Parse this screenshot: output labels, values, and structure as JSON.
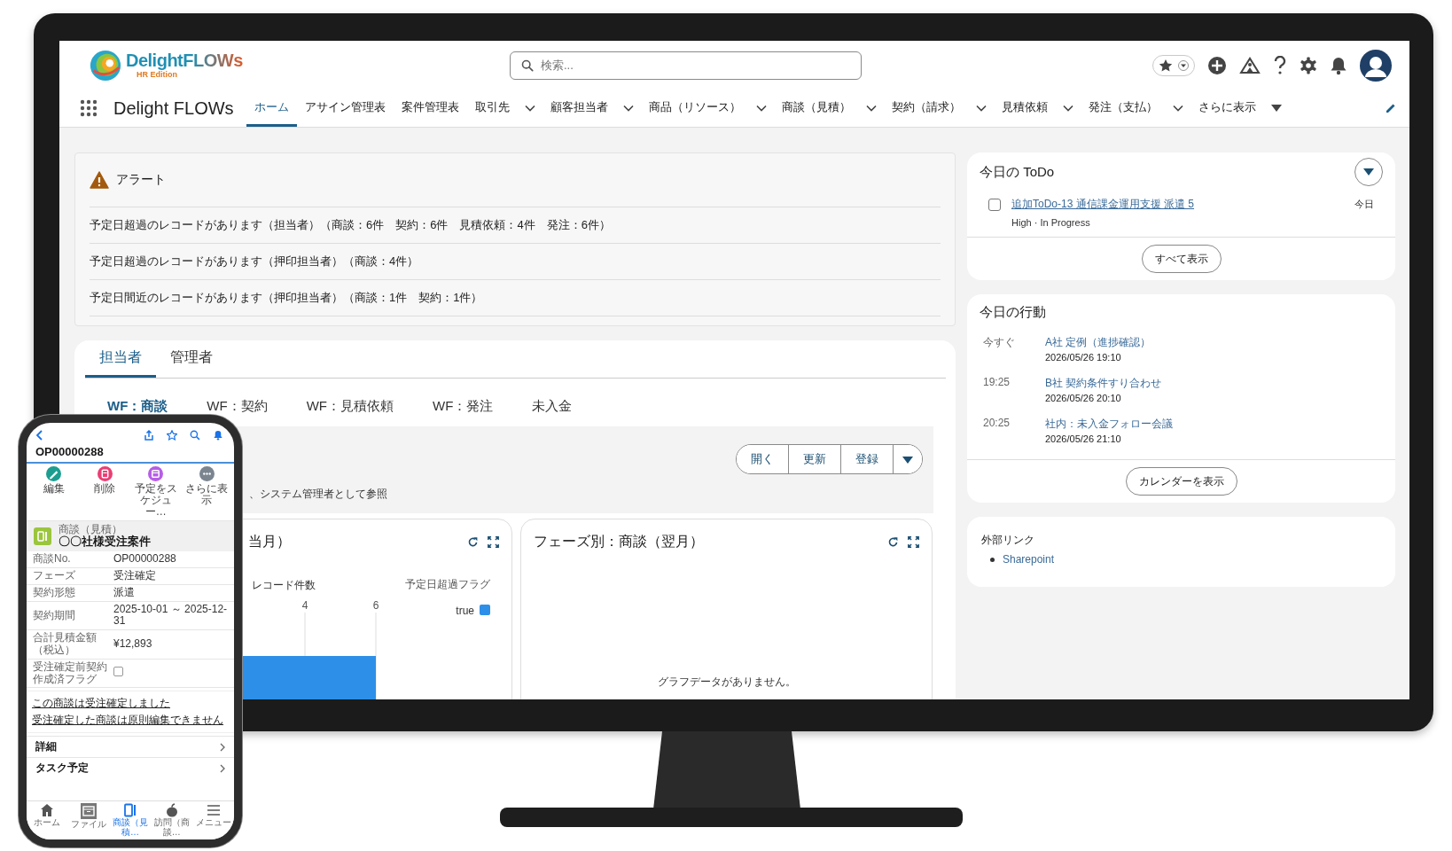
{
  "header": {
    "logo": {
      "name": "DelightFLOWs",
      "edition": "HR Edition"
    },
    "search": {
      "placeholder": "検索..."
    },
    "app_name": "Delight FLOWs",
    "nav": [
      {
        "label": "ホーム",
        "selected": true,
        "menu": false
      },
      {
        "label": "アサイン管理表",
        "selected": false,
        "menu": false
      },
      {
        "label": "案件管理表",
        "selected": false,
        "menu": false
      },
      {
        "label": "取引先",
        "selected": false,
        "menu": true
      },
      {
        "label": "顧客担当者",
        "selected": false,
        "menu": true
      },
      {
        "label": "商品（リソース）",
        "selected": false,
        "menu": true
      },
      {
        "label": "商談（見積）",
        "selected": false,
        "menu": true
      },
      {
        "label": "契約（請求）",
        "selected": false,
        "menu": true
      },
      {
        "label": "見積依頼",
        "selected": false,
        "menu": true
      },
      {
        "label": "発注（支払）",
        "selected": false,
        "menu": true
      }
    ],
    "nav_more": "さらに表示"
  },
  "main": {
    "alert": {
      "title": "アラート",
      "messages": [
        "予定日超過のレコードがあります（担当者）（商談：6件　契約：6件　見積依頼：4件　発注：6件）",
        "予定日超過のレコードがあります（押印担当者）（商談：4件）",
        "予定日間近のレコードがあります（押印担当者）（商談：1件　契約：1件）"
      ]
    },
    "role_tabs": [
      {
        "label": "担当者",
        "selected": true
      },
      {
        "label": "管理者",
        "selected": false
      }
    ],
    "sub_tabs": [
      {
        "label": "WF：商談",
        "selected": true
      },
      {
        "label": "WF：契約",
        "selected": false
      },
      {
        "label": "WF：見積依頼",
        "selected": false
      },
      {
        "label": "WF：発注",
        "selected": false
      },
      {
        "label": "未入金",
        "selected": false
      }
    ],
    "list_actions": [
      "開く",
      "更新",
      "登録"
    ],
    "list_note": "、システム管理者として参照",
    "charts": [
      {
        "title": "当月）",
        "legend_title": "予定日超過フラグ",
        "chart_data": {
          "type": "bar",
          "orientation": "horizontal",
          "xlabel": "レコード件数",
          "xlim": [
            0,
            6
          ],
          "xticks": [
            4,
            6
          ],
          "series": [
            {
              "name": "true",
              "color": "#2e8fe8",
              "values": [
                6
              ]
            }
          ]
        }
      },
      {
        "title": "フェーズ別：商談（翌月）",
        "empty_message": "グラフデータがありません。"
      }
    ]
  },
  "side": {
    "todo": {
      "title": "今日の ToDo",
      "items": [
        {
          "checked": false,
          "label": "追加ToDo-13 通信課金運用支援 派遣 5",
          "meta": "High · In Progress",
          "due": "今日"
        }
      ],
      "button": "すべて表示"
    },
    "events": {
      "title": "今日の行動",
      "items": [
        {
          "time": "今すぐ",
          "title": "A社 定例（進捗確認）",
          "datetime": "2026/05/26 19:10"
        },
        {
          "time": "19:25",
          "title": "B社 契約条件すり合わせ",
          "datetime": "2026/05/26 20:10"
        },
        {
          "time": "20:25",
          "title": "社内：未入金フォロー会議",
          "datetime": "2026/05/26 21:10"
        }
      ],
      "button": "カレンダーを表示"
    },
    "links": {
      "title": "外部リンク",
      "items": [
        "Sharepoint"
      ]
    }
  },
  "phone": {
    "record_id": "OP00000288",
    "actions": [
      {
        "label": "編集",
        "color": "#1b9e8f"
      },
      {
        "label": "削除",
        "color": "#ea3e73"
      },
      {
        "label": "予定をスケジュー…",
        "color": "#b65ee6"
      },
      {
        "label": "さらに表示",
        "color": "#7a8590"
      }
    ],
    "object_type": "商談（見積）",
    "record_name": "〇〇社様受注案件",
    "fields": [
      {
        "kind": "text",
        "label": "商談No.",
        "value": "OP00000288"
      },
      {
        "kind": "text",
        "label": "フェーズ",
        "value": "受注確定"
      },
      {
        "kind": "text",
        "label": "契約形態",
        "value": "派遣"
      },
      {
        "kind": "text",
        "label": "契約期間",
        "value": "2025-10-01 ～ 2025-12-31"
      },
      {
        "kind": "text",
        "label": "合計見積金額（税込）",
        "value": "¥12,893"
      },
      {
        "kind": "checkbox",
        "label": "受注確定前契約作成済フラグ",
        "checked": false
      }
    ],
    "notices": [
      "この商談は受注確定しました",
      "受注確定した商談は原則編集できません"
    ],
    "sections": [
      "詳細",
      "タスク予定"
    ],
    "tabs": [
      {
        "label": "ホーム",
        "selected": false
      },
      {
        "label": "ファイル",
        "selected": false
      },
      {
        "label": "商談（見積…",
        "selected": true
      },
      {
        "label": "訪問（商談…",
        "selected": false
      },
      {
        "label": "メニュー",
        "selected": false
      }
    ]
  }
}
